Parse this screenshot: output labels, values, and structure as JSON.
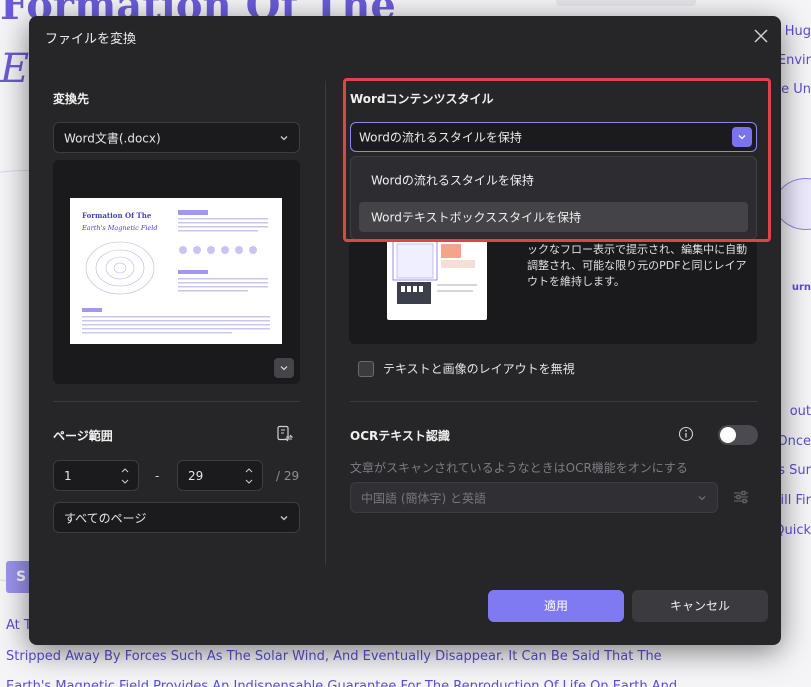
{
  "background_doc": {
    "title_top": "Formation Of The",
    "title_italic": "E",
    "right_fragments": [
      "Hug",
      "Envir",
      "e Un",
      "out",
      "Once",
      "s Sur",
      "ill Fir",
      "Quick"
    ],
    "line_1": "At T",
    "line_2": "Stripped Away By Forces Such As The Solar Wind, And Eventually Disappear. It Can Be Said That The",
    "line_3": "Earth's Magnetic Field Provides An Indispensable Guarantee For The Reproduction Of Life On Earth And",
    "button_fragment": "S",
    "bulb_caption": "urn"
  },
  "dialog": {
    "title": "ファイルを変換",
    "left": {
      "format_label": "変換先",
      "format_value": "Word文書(.docx)",
      "thumbnail": {
        "title_line1": "Formation Of The",
        "title_line2": "Earth's Magnetic Field"
      },
      "page_range_label": "ページ範囲",
      "page_from": "1",
      "page_to": "29",
      "dash": "-",
      "page_total": "/ 29",
      "page_select_value": "すべてのページ"
    },
    "right": {
      "style_label": "Wordコンテンツスタイル",
      "style_selected": "Wordの流れるスタイルを保持",
      "style_options": [
        "Wordの流れるスタイルを保持",
        "Wordテキストボックススタイルを保持"
      ],
      "description": "ックなフロー表示で提示され、編集中に自動調整され、可能な限り元のPDFと同じレイアウトを維持します。",
      "ignore_layout_label": "テキストと画像のレイアウトを無視",
      "ocr_label": "OCRテキスト認識",
      "ocr_description": "文章がスキャンされているようなときはOCR機能をオンにする",
      "ocr_enabled": false,
      "ocr_language": "中国語 (簡体字) と英語"
    },
    "buttons": {
      "apply": "適用",
      "cancel": "キャンセル"
    }
  },
  "colors": {
    "accent": "#7f7af2",
    "dialog_bg": "#262629",
    "highlight": "#e0444a",
    "bg_text": "#5a4fcf"
  }
}
